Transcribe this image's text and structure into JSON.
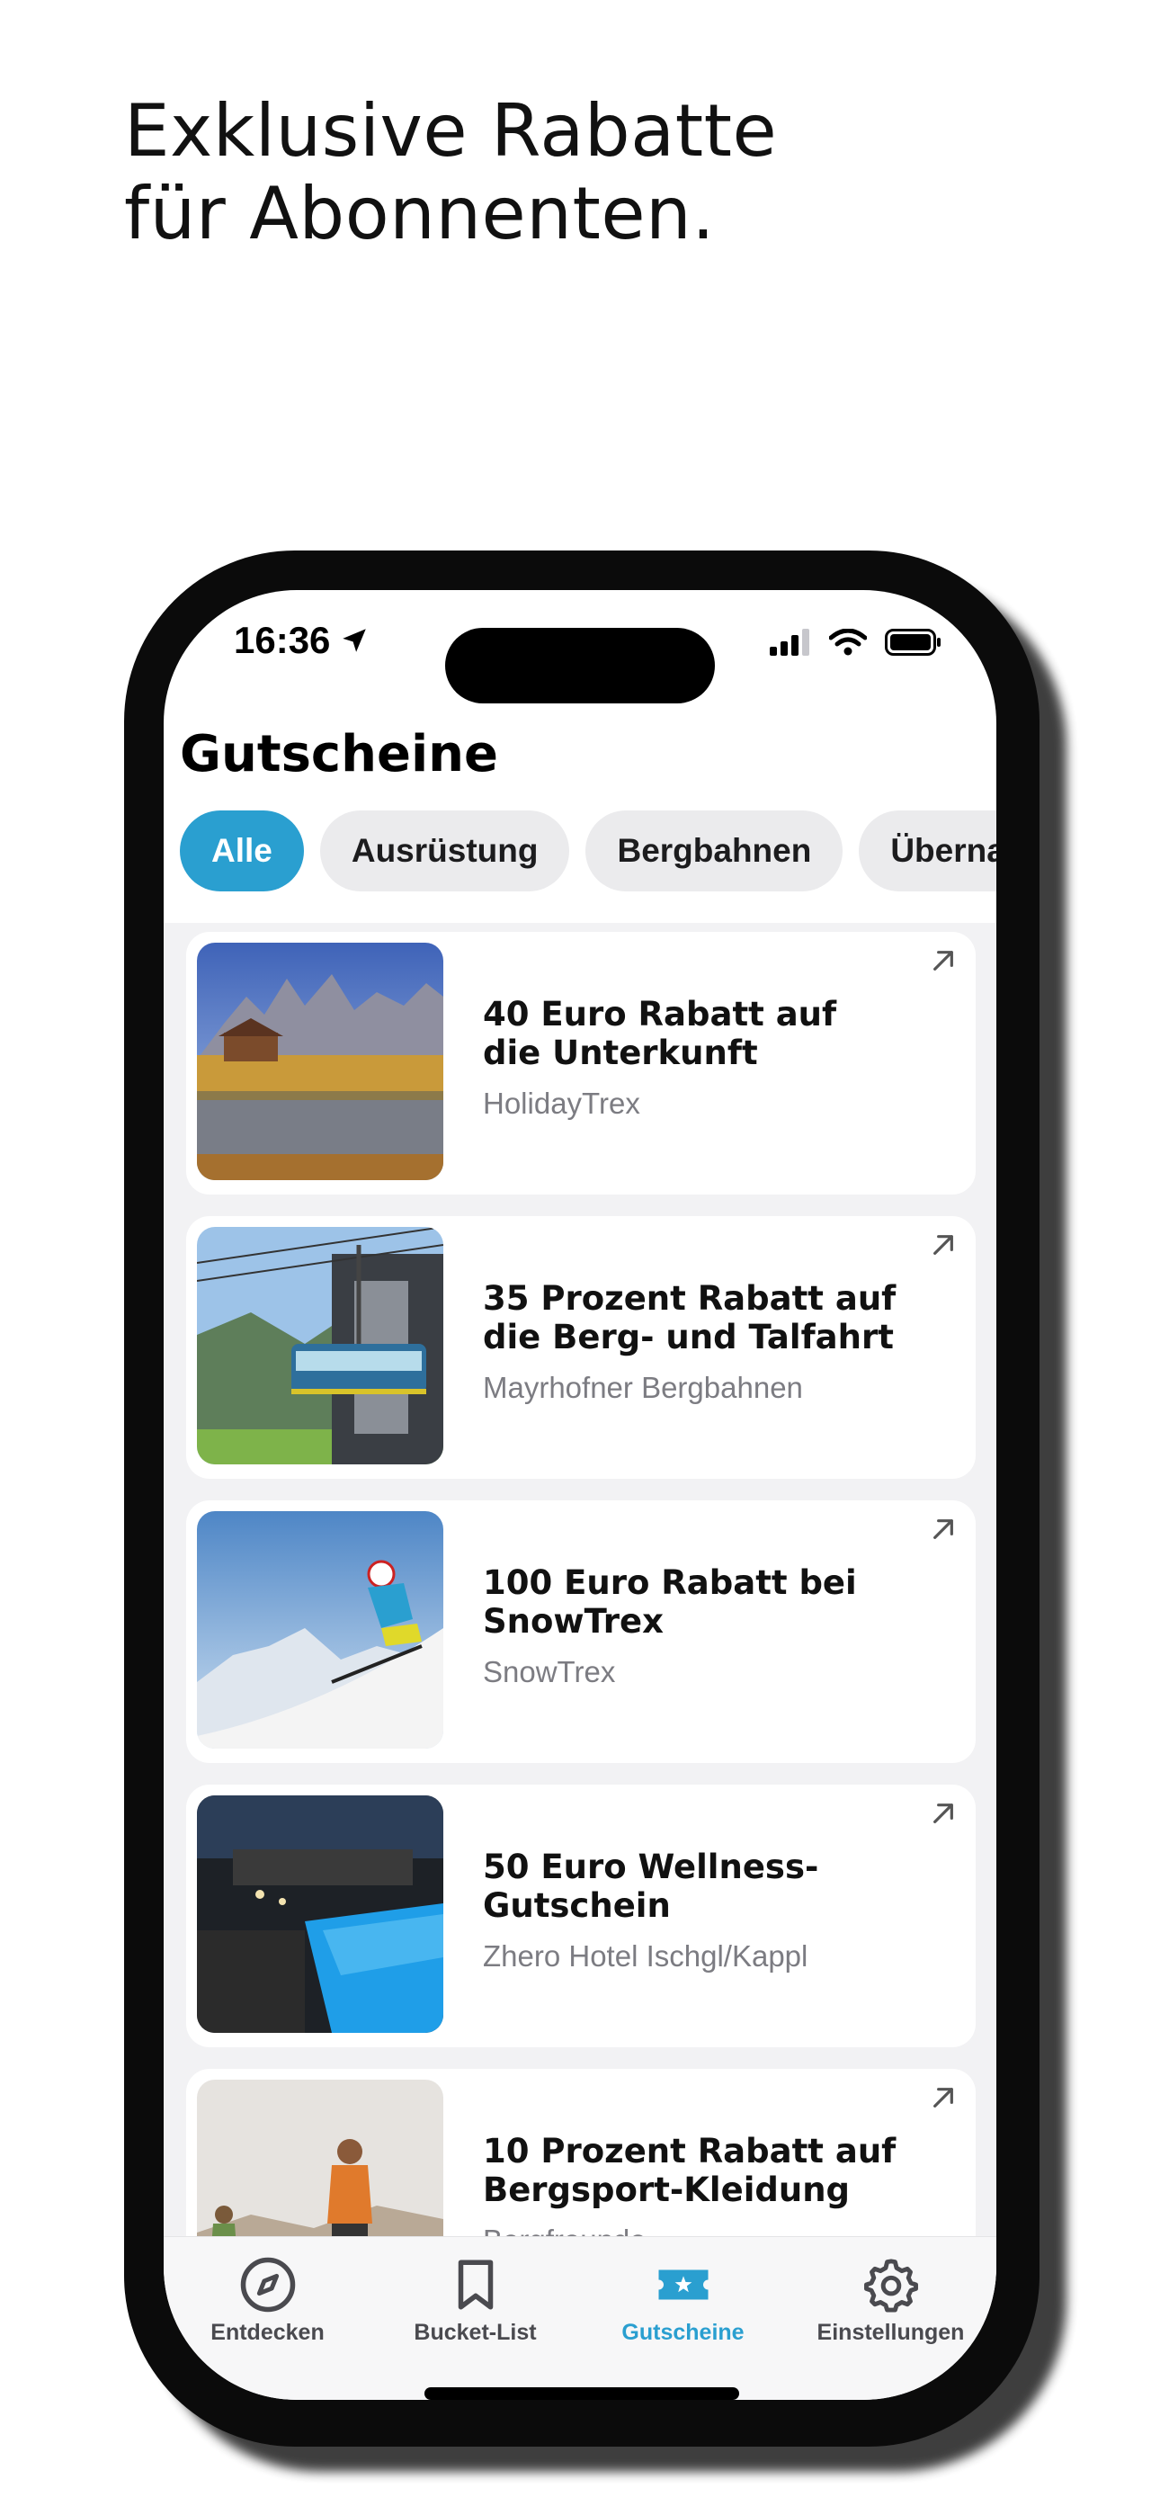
{
  "marketing": {
    "line1": "Exklusive Rabatte",
    "line2": "für Abonnenten."
  },
  "status_bar": {
    "time": "16:36",
    "icons": [
      "location-arrow-icon",
      "signal-icon",
      "wifi-icon",
      "battery-icon"
    ]
  },
  "page": {
    "title": "Gutscheine"
  },
  "filters": [
    {
      "label": "Alle",
      "active": true
    },
    {
      "label": "Ausrüstung",
      "active": false
    },
    {
      "label": "Bergbahnen",
      "active": false
    },
    {
      "label": "Übernac",
      "active": false
    }
  ],
  "vouchers": [
    {
      "title": "40 Euro Rabatt auf die Unterkunft",
      "provider": "HolidayTrex",
      "image": "mountain-lake-chalet"
    },
    {
      "title": "35 Prozent Rabatt auf die Berg- und Talfahrt",
      "provider": "Mayrhofner Bergbahnen",
      "image": "cable-car-gondola"
    },
    {
      "title": "100 Euro Rabatt bei SnowTrex",
      "provider": "SnowTrex",
      "image": "skier-snow-slope"
    },
    {
      "title": "50 Euro Wellness-Gutschein",
      "provider": "Zhero Hotel Ischgl/Kappl",
      "image": "indoor-pool"
    },
    {
      "title": "10 Prozent Rabatt auf Bergsport-Kleidung",
      "provider": "Bergfreunde",
      "image": "hikers"
    }
  ],
  "tabbar": [
    {
      "label": "Entdecken",
      "icon": "compass-icon",
      "active": false
    },
    {
      "label": "Bucket-List",
      "icon": "bookmark-icon",
      "active": false
    },
    {
      "label": "Gutscheine",
      "icon": "ticket-icon",
      "active": true
    },
    {
      "label": "Einstellungen",
      "icon": "gear-icon",
      "active": false
    }
  ],
  "colors": {
    "accent": "#2a9fd0",
    "chip_bg": "#ebebed",
    "list_bg": "#f2f2f4",
    "muted_text": "#7c7c82"
  }
}
